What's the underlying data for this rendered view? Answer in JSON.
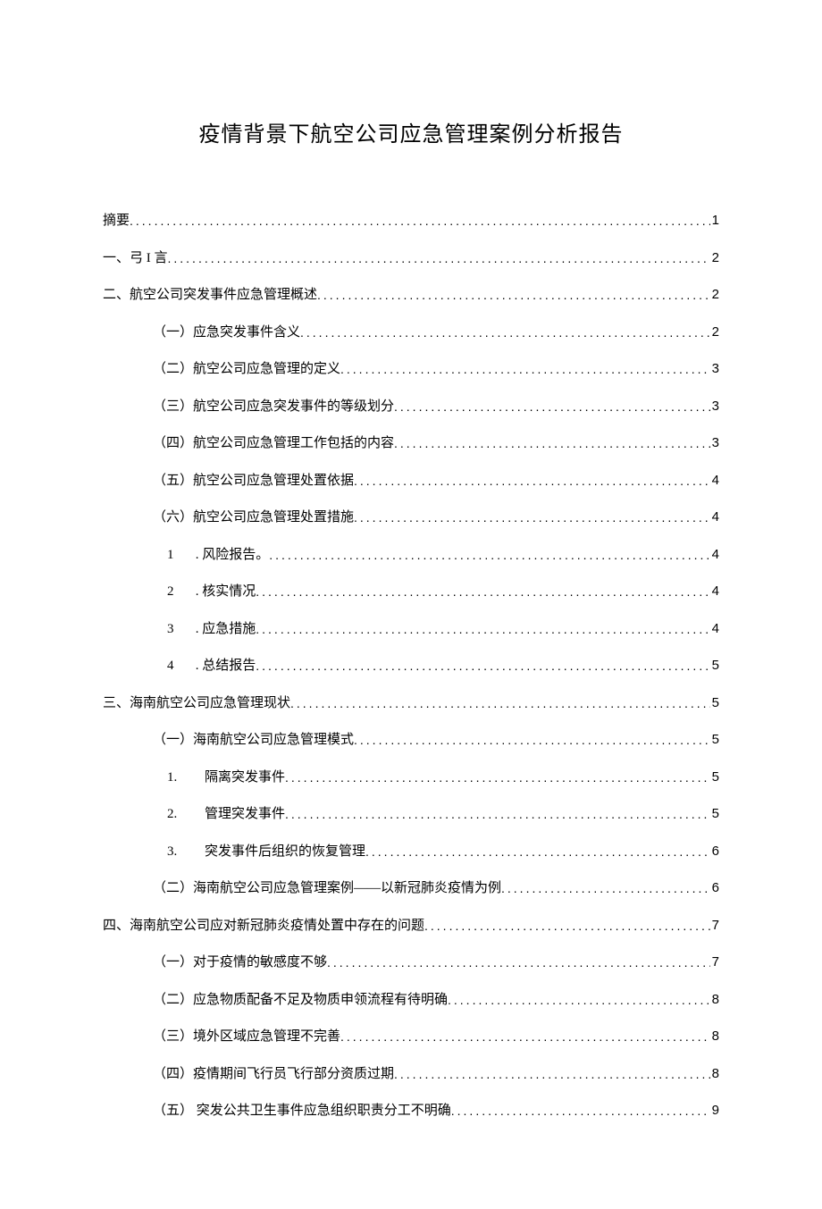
{
  "title": "疫情背景下航空公司应急管理案例分析报告",
  "toc": [
    {
      "level": 0,
      "label": "摘要",
      "page": "1"
    },
    {
      "level": 0,
      "label": "一、弓 I 言 ",
      "page": "2"
    },
    {
      "level": 0,
      "label": "二、航空公司突发事件应急管理概述",
      "page": "2"
    },
    {
      "level": 1,
      "label": "（一）应急突发事件含义",
      "page": "2"
    },
    {
      "level": 1,
      "label": "（二）航空公司应急管理的定义",
      "page": "3"
    },
    {
      "level": 1,
      "label": "（三）航空公司应急突发事件的等级划分",
      "page": "3"
    },
    {
      "level": 1,
      "label": "（四）航空公司应急管理工作包括的内容",
      "page": "3"
    },
    {
      "level": 1,
      "label": "（五）航空公司应急管理处置依据",
      "page": "4"
    },
    {
      "level": 1,
      "label": "（六）航空公司应急管理处置措施",
      "page": "4"
    },
    {
      "level": 2,
      "num": "1",
      "sep": " . ",
      "label": "风险报告。 ",
      "page": "4"
    },
    {
      "level": 2,
      "num": "2",
      "sep": " . ",
      "label": "核实情况 ",
      "page": "4"
    },
    {
      "level": 2,
      "num": "3",
      "sep": " . ",
      "label": "应急措施 ",
      "page": "4"
    },
    {
      "level": 2,
      "num": "4",
      "sep": " . ",
      "label": "总结报告 ",
      "page": "5"
    },
    {
      "level": 0,
      "label": "三、海南航空公司应急管理现状",
      "page": "5"
    },
    {
      "level": 1,
      "label": "（一）海南航空公司应急管理模式",
      "page": "5"
    },
    {
      "level": 3,
      "num": "1.",
      "label": "隔离突发事件",
      "page": "5"
    },
    {
      "level": 3,
      "num": "2.",
      "label": "管理突发事件",
      "page": "5"
    },
    {
      "level": 3,
      "num": "3.",
      "label": "突发事件后组织的恢复管理",
      "page": "6"
    },
    {
      "level": 1,
      "label": "（二）海南航空公司应急管理案例——以新冠肺炎疫情为例",
      "page": "6"
    },
    {
      "level": 0,
      "label": "四、海南航空公司应对新冠肺炎疫情处置中存在的问题",
      "page": "7"
    },
    {
      "level": 1,
      "label": "（一）对于疫情的敏感度不够",
      "page": "7"
    },
    {
      "level": 1,
      "label": "（二）应急物质配备不足及物质申领流程有待明确",
      "page": "8"
    },
    {
      "level": 1,
      "label": "（三）境外区域应急管理不完善",
      "page": "8"
    },
    {
      "level": 1,
      "label": "（四）疫情期间飞行员飞行部分资质过期",
      "page": "8"
    },
    {
      "level": 1,
      "label": "（五）  突发公共卫生事件应急组织职责分工不明确",
      "page": "9"
    }
  ]
}
